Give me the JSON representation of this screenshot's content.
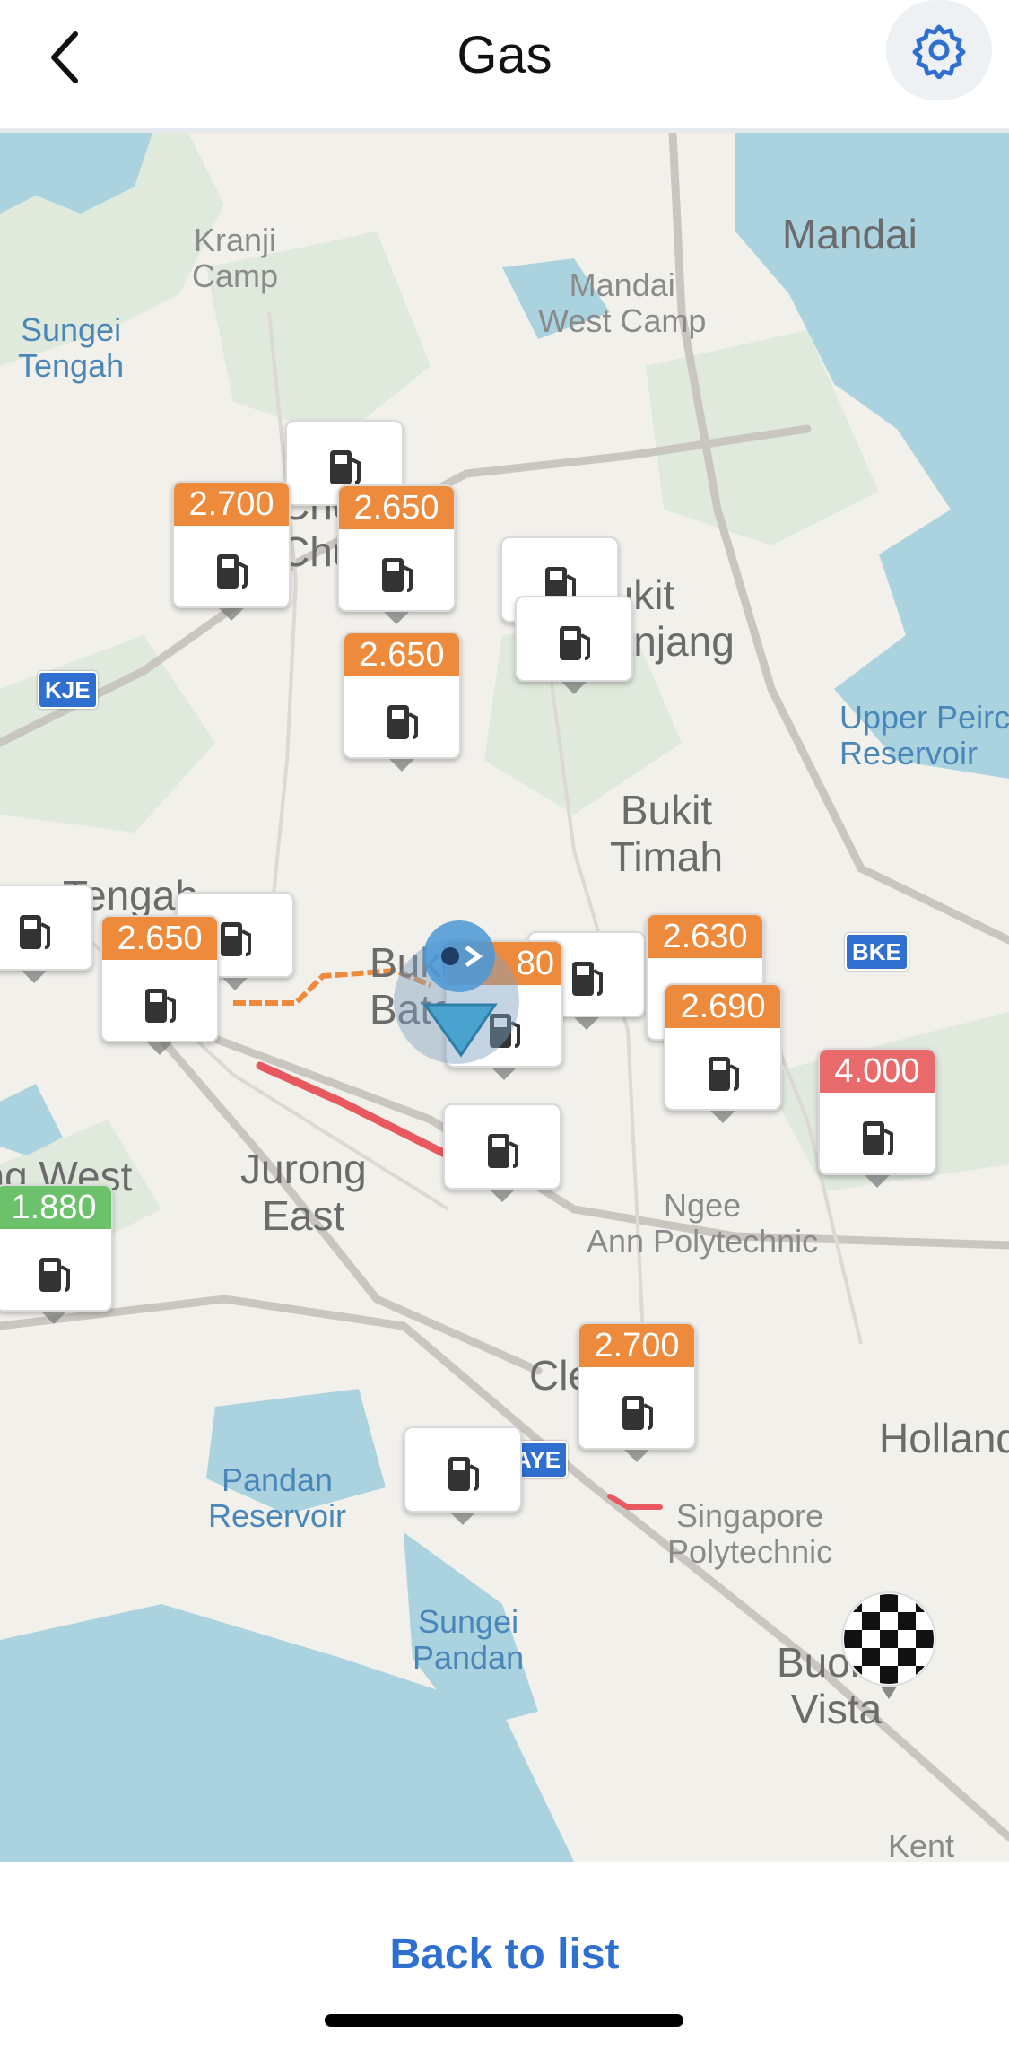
{
  "header": {
    "title": "Gas"
  },
  "places": {
    "mandai": "Mandai",
    "kranji_camp": "Kranji\nCamp",
    "mandai_west_camp": "Mandai\nWest Camp",
    "sungei_tengah": "Sungei\nTengah",
    "bukit_panjang": "Bukit\nPanjang",
    "upper_peirce": "Upper Peirce\nReservoir",
    "bukit_timah": "Bukit\nTimah",
    "tengah": "Tengah",
    "bukit_batok": "Bukit\nBatok",
    "jurong_east": "Jurong\nEast",
    "ngee_ann": "Ngee\nAnn Polytechnic",
    "jurong_west": "Jurong West",
    "clementi": "Clementi",
    "holland": "Holland",
    "pandan_reservoir": "Pandan\nReservoir",
    "singapore_poly": "Singapore\nPolytechnic",
    "sungei_pandan": "Sungei\nPandan",
    "buona_vista": "Buona\nVista",
    "kent": "Kent",
    "choa_chu_kang": "Choa\nChu"
  },
  "expressways": {
    "kje": "KJE",
    "bke": "BKE",
    "aye": "AYE"
  },
  "stations": [
    {
      "price": "",
      "tone": "none"
    },
    {
      "price": "2.700",
      "tone": "orange"
    },
    {
      "price": "2.650",
      "tone": "orange"
    },
    {
      "price": "",
      "tone": "none"
    },
    {
      "price": "",
      "tone": "none"
    },
    {
      "price": "2.650",
      "tone": "orange"
    },
    {
      "price": "",
      "tone": "none"
    },
    {
      "price": "",
      "tone": "none"
    },
    {
      "price": "2.650",
      "tone": "orange"
    },
    {
      "price": "",
      "tone": "none"
    },
    {
      "price": "",
      "tone": "none"
    },
    {
      "price": "2.630",
      "tone": "orange"
    },
    {
      "price": "2.690",
      "tone": "orange"
    },
    {
      "price": "4.000",
      "tone": "red"
    },
    {
      "price": "",
      "tone": "none"
    },
    {
      "price": "1.880",
      "tone": "green"
    },
    {
      "price": "2.700",
      "tone": "orange"
    },
    {
      "price": "",
      "tone": "none"
    }
  ],
  "partial_price": "80",
  "colors": {
    "orange": "#ee8a3b",
    "red": "#e86a6a",
    "green": "#6cc26a",
    "accent": "#2f6fd0"
  },
  "icons": {
    "back": "chevron-left-icon",
    "settings": "gear-icon",
    "station": "fuel-pump-icon",
    "destination": "checkered-flag-icon",
    "user": "user-location-icon"
  },
  "footer": {
    "back_to_list": "Back to list"
  }
}
